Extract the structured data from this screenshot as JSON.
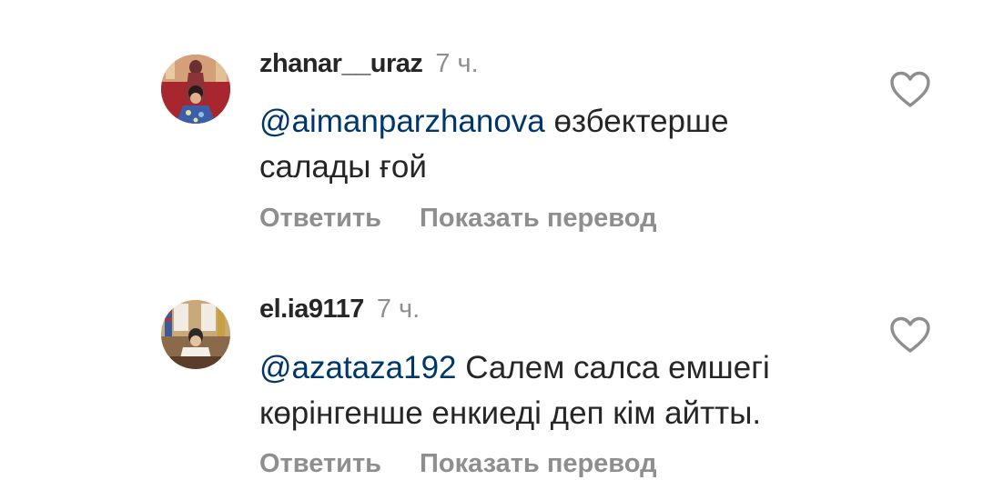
{
  "comments": [
    {
      "username": "zhanar__uraz",
      "time": "7 ч.",
      "mention": "@aimanparzhanova",
      "text": " өзбектерше салады ғой",
      "reply_label": "Ответить",
      "translate_label": "Показать перевод"
    },
    {
      "username": "el.ia9117",
      "time": "7 ч.",
      "mention": "@azataza192",
      "text": " Салем салса емшегі көрінгенше енкиеді деп кім айтты.",
      "reply_label": "Ответить",
      "translate_label": "Показать перевод"
    }
  ],
  "colors": {
    "username": "#262626",
    "meta": "#8e8e8e",
    "mention": "#00376b",
    "text": "#262626"
  }
}
